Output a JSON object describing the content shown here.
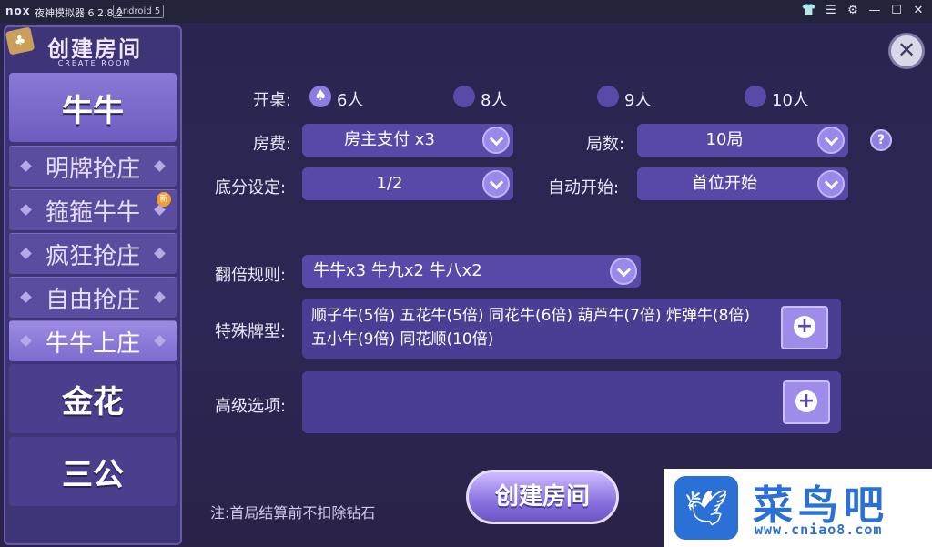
{
  "window": {
    "brand": "nox",
    "title": "夜神模拟器 6.2.8.2",
    "android_badge": "Android 5",
    "controls": [
      "shirt-icon",
      "menu-icon",
      "gear-icon",
      "minimize-icon",
      "maximize-icon",
      "close-icon"
    ]
  },
  "sidebar": {
    "logo_main": "创建房间",
    "logo_sub": "CREATE ROOM",
    "game_tabs": [
      "牛牛",
      "金花",
      "三公"
    ],
    "modes": [
      {
        "label": "明牌抢庄",
        "new": false
      },
      {
        "label": "箍箍牛牛",
        "new": true,
        "badge": "新"
      },
      {
        "label": "疯狂抢庄",
        "new": false
      },
      {
        "label": "自由抢庄",
        "new": false
      },
      {
        "label": "牛牛上庄",
        "new": false
      }
    ],
    "active_tab": "牛牛",
    "active_mode": "牛牛上庄"
  },
  "form": {
    "table_label": "开桌:",
    "table_options": [
      "6人",
      "8人",
      "9人",
      "10人"
    ],
    "table_selected": "6人",
    "fee_label": "房费:",
    "fee_value": "房主支付 x3",
    "rounds_label": "局数:",
    "rounds_value": "10局",
    "help": "?",
    "base_label": "底分设定:",
    "base_value": "1/2",
    "auto_label": "自动开始:",
    "auto_value": "首位开始",
    "double_label": "翻倍规则:",
    "double_value": "牛牛x3  牛九x2  牛八x2",
    "special_label": "特殊牌型:",
    "special_value": "顺子牛(5倍)  五花牛(5倍)  同花牛(6倍)  葫芦牛(7倍)  炸弹牛(8倍)  五小牛(9倍)  同花顺(10倍)",
    "advanced_label": "高级选项:",
    "advanced_value": "",
    "plus": "+",
    "close": "✕"
  },
  "create_button": "创建房间",
  "note": "注:首局结算前不扣除钻石",
  "watermark": {
    "text": "菜鸟吧",
    "url": "www.cniao8.com"
  }
}
